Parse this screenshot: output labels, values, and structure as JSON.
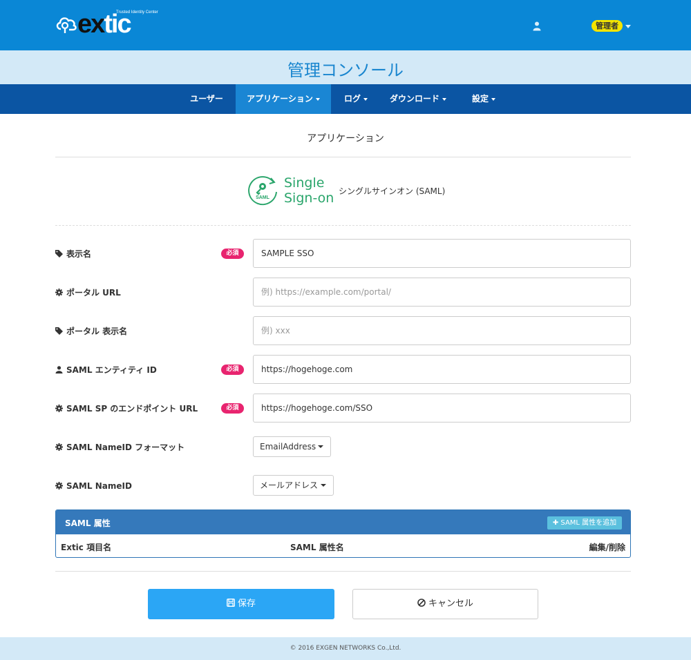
{
  "header": {
    "logo_tagline": "Trusted Identity Center",
    "logo_word_ex": "ex",
    "logo_word_tic": "tic",
    "admin_label": "管理者"
  },
  "title_band": "管理コンソール",
  "nav": {
    "items": [
      {
        "label": "ユーザー",
        "dropdown": false,
        "active": false
      },
      {
        "label": "アプリケーション",
        "dropdown": true,
        "active": true
      },
      {
        "label": "ログ",
        "dropdown": true,
        "active": false
      },
      {
        "label": "ダウンロード",
        "dropdown": true,
        "active": false
      },
      {
        "label": "設定",
        "dropdown": true,
        "active": false
      }
    ]
  },
  "section_title": "アプリケーション",
  "app": {
    "logo_line1": "Single",
    "logo_line2": "Sign-on",
    "logo_badge": "SAML",
    "description": "シングルサインオン (SAML)"
  },
  "form": {
    "required_label": "必須",
    "display_name": {
      "label": "表示名",
      "value": "SAMPLE SSO",
      "placeholder": "",
      "icon": "tag-icon"
    },
    "portal_url": {
      "label": "ポータル URL",
      "value": "",
      "placeholder": "例) https://example.com/portal/",
      "icon": "gear-icon"
    },
    "portal_display_name": {
      "label": "ポータル 表示名",
      "value": "",
      "placeholder": "例) xxx",
      "icon": "tag-icon"
    },
    "saml_entity_id": {
      "label": "SAML エンティティ ID",
      "value": "https://hogehoge.com",
      "placeholder": "",
      "icon": "user-icon"
    },
    "saml_sp_endpoint": {
      "label": "SAML SP のエンドポイント URL",
      "value": "https://hogehoge.com/SSO",
      "placeholder": "",
      "icon": "gear-icon"
    },
    "nameid_format": {
      "label": "SAML NameID フォーマット",
      "selected": "EmailAddress",
      "icon": "gear-icon"
    },
    "nameid": {
      "label": "SAML NameID",
      "selected": "メールアドレス",
      "icon": "gear-icon"
    }
  },
  "saml_attributes": {
    "title": "SAML 属性",
    "add_label": "SAML 属性を追加",
    "columns": [
      "Extic 項目名",
      "SAML 属性名",
      "編集/削除"
    ]
  },
  "buttons": {
    "save": "保存",
    "cancel": "キャンセル"
  },
  "footer": "© 2016 EXGEN NETWORKS Co.,Ltd.",
  "colors": {
    "header_blue": "#0a87d6",
    "nav_blue": "#0b55a3",
    "nav_active": "#1a86d4",
    "title_band": "#d3e9f7",
    "required_pink": "#e8246f",
    "save_blue": "#2ba6f5",
    "sso_green": "#2aa56b",
    "admin_yellow": "#f3e400"
  }
}
